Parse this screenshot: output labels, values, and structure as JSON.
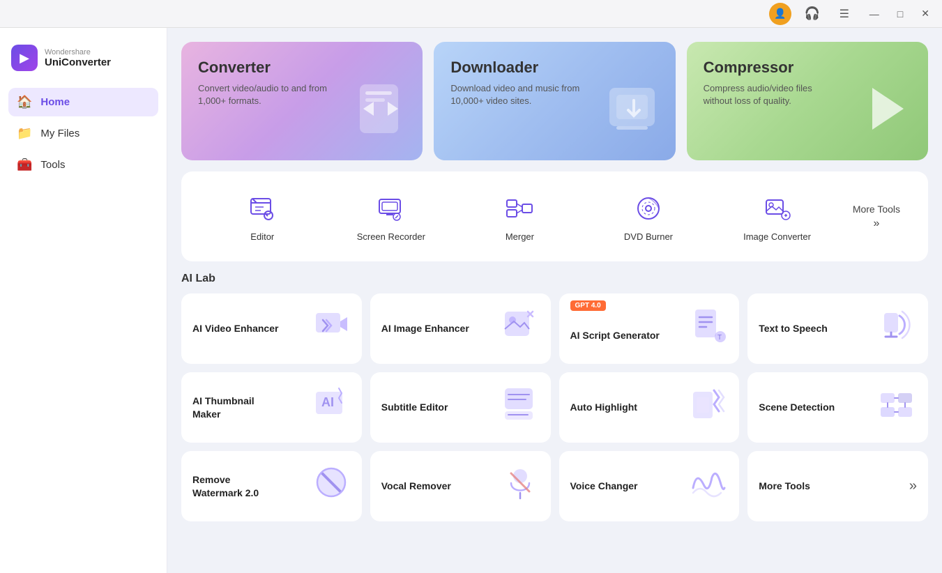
{
  "titlebar": {
    "minimize": "—",
    "maximize": "□",
    "close": "✕"
  },
  "logo": {
    "brand": "Wondershare",
    "product": "UniConverter"
  },
  "sidebar": {
    "items": [
      {
        "label": "Home",
        "icon": "🏠",
        "active": true
      },
      {
        "label": "My Files",
        "icon": "📁",
        "active": false
      },
      {
        "label": "Tools",
        "icon": "🧰",
        "active": false
      }
    ]
  },
  "top_cards": [
    {
      "key": "converter",
      "title": "Converter",
      "desc": "Convert video/audio to and from 1,000+ formats.",
      "icon": "🔄"
    },
    {
      "key": "downloader",
      "title": "Downloader",
      "desc": "Download video and music from 10,000+ video sites.",
      "icon": "⬇️"
    },
    {
      "key": "compressor",
      "title": "Compressor",
      "desc": "Compress audio/video files without loss of quality.",
      "icon": "▶️"
    }
  ],
  "tools": {
    "items": [
      {
        "label": "Editor",
        "icon": "✂️"
      },
      {
        "label": "Screen Recorder",
        "icon": "🖥️"
      },
      {
        "label": "Merger",
        "icon": "🔀"
      },
      {
        "label": "DVD Burner",
        "icon": "💿"
      },
      {
        "label": "Image Converter",
        "icon": "🖼️"
      }
    ],
    "more_label": "More Tools"
  },
  "ai_lab": {
    "title": "AI Lab",
    "row1": [
      {
        "label": "AI Video Enhancer",
        "icon": "🎬",
        "badge": null
      },
      {
        "label": "AI Image Enhancer",
        "icon": "🖼️",
        "badge": null
      },
      {
        "label": "AI Script Generator",
        "icon": "📝",
        "badge": "GPT 4.0"
      },
      {
        "label": "Text to Speech",
        "icon": "🔊",
        "badge": null
      }
    ],
    "row2": [
      {
        "label": "AI Thumbnail Maker",
        "icon": "🤖",
        "badge": null
      },
      {
        "label": "Subtitle Editor",
        "icon": "💬",
        "badge": null
      },
      {
        "label": "Auto Highlight",
        "icon": "✨",
        "badge": null
      },
      {
        "label": "Scene Detection",
        "icon": "🎞️",
        "badge": null
      }
    ],
    "row3": [
      {
        "label": "Remove Watermark 2.0",
        "icon": "🚫",
        "badge": null
      },
      {
        "label": "Vocal Remover",
        "icon": "🎤",
        "badge": null
      },
      {
        "label": "Voice Changer",
        "icon": "🎵",
        "badge": null
      },
      {
        "label": "More Tools",
        "icon": null,
        "is_more": true
      }
    ]
  }
}
